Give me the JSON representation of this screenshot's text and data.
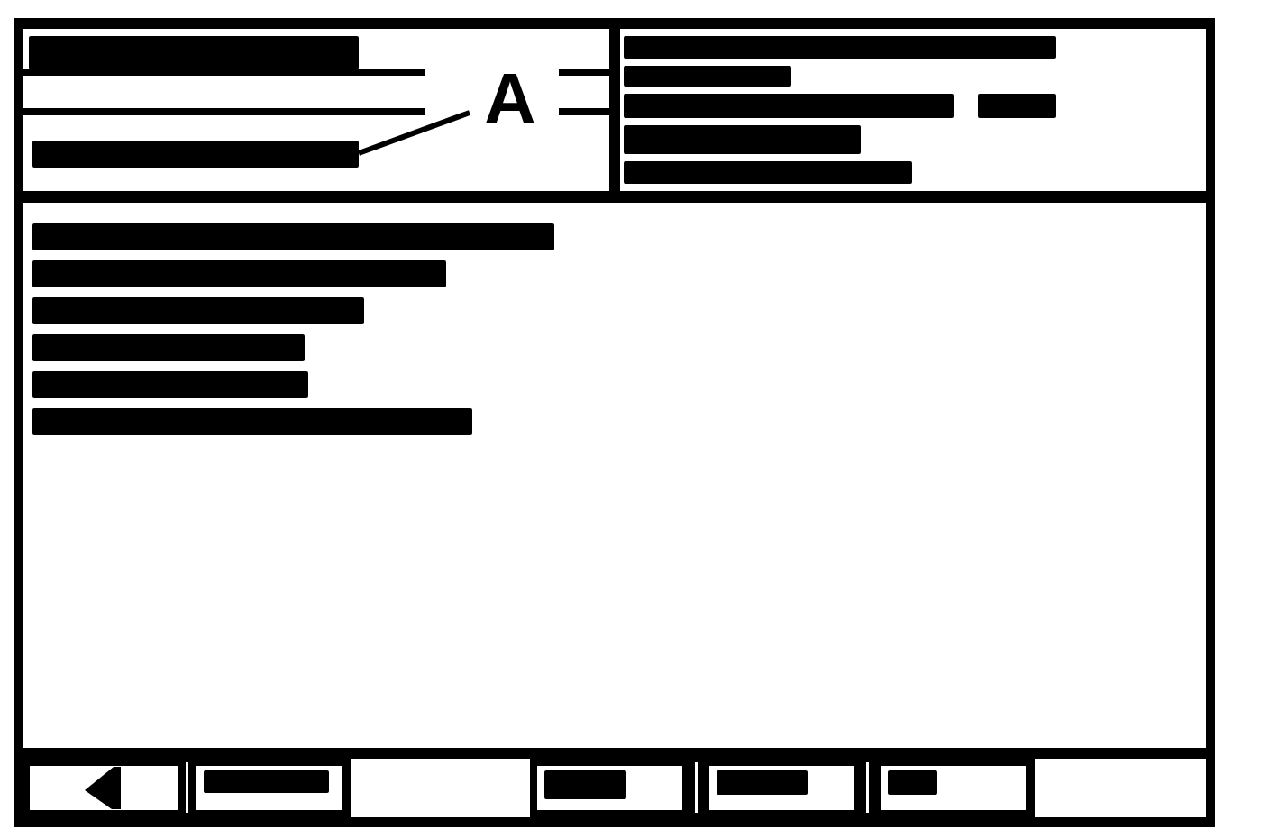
{
  "header": {
    "diagram": {
      "title": {
        "kind": "redacted"
      },
      "callout_label": "A",
      "pointed_label": {
        "kind": "redacted"
      }
    },
    "info_lines": [
      {
        "kind": "redacted"
      },
      {
        "kind": "redacted"
      },
      {
        "kind": "redacted_pair"
      },
      {
        "kind": "redacted"
      },
      {
        "kind": "redacted"
      }
    ]
  },
  "body_lines": [
    {
      "kind": "redacted"
    },
    {
      "kind": "redacted"
    },
    {
      "kind": "redacted"
    },
    {
      "kind": "redacted"
    },
    {
      "kind": "redacted"
    },
    {
      "kind": "redacted"
    }
  ],
  "softkeys": [
    {
      "kind": "back"
    },
    {
      "kind": "redacted"
    },
    {
      "kind": "blank"
    },
    {
      "kind": "redacted"
    },
    {
      "kind": "redacted"
    },
    {
      "kind": "redacted"
    },
    {
      "kind": "blank"
    }
  ]
}
